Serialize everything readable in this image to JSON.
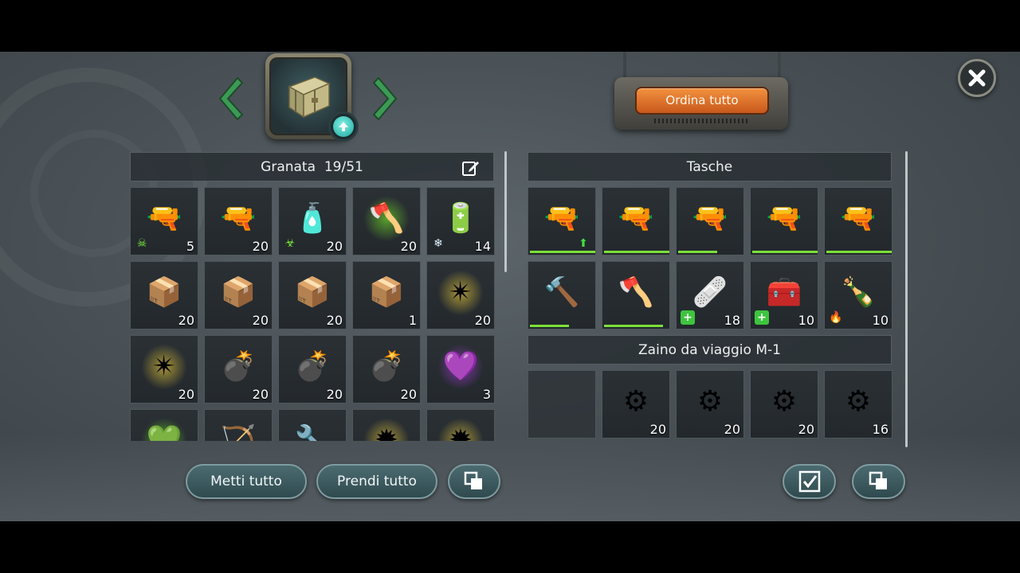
{
  "container": {
    "header_label": "Granata",
    "header_count": "19/51"
  },
  "sort_button": "Ordina tutto",
  "pockets": {
    "title": "Tasche",
    "items": [
      {
        "name": "rifle-green-upgrade",
        "glyph": "🔫",
        "qty": "",
        "durability": 1.0,
        "corner": "up-arrow"
      },
      {
        "name": "rifle-green",
        "glyph": "🔫",
        "qty": "",
        "durability": 1.0,
        "corner": ""
      },
      {
        "name": "rifle-green",
        "glyph": "🔫",
        "qty": "",
        "durability": 0.6,
        "corner": ""
      },
      {
        "name": "rifle-green",
        "glyph": "🔫",
        "qty": "",
        "durability": 1.0,
        "corner": ""
      },
      {
        "name": "hunting-rifle",
        "glyph": "🔫",
        "qty": "",
        "durability": 1.0,
        "corner": ""
      },
      {
        "name": "sledgehammer",
        "glyph": "🔨",
        "qty": "",
        "durability": 0.6,
        "corner": ""
      },
      {
        "name": "axe",
        "glyph": "🪓",
        "qty": "",
        "durability": 0.9,
        "corner": ""
      },
      {
        "name": "bandage",
        "glyph": "🩹",
        "qty": "18",
        "durability": null,
        "corner": "medkit"
      },
      {
        "name": "medical-device",
        "glyph": "🧰",
        "qty": "10",
        "durability": null,
        "corner": "medkit"
      },
      {
        "name": "molotov",
        "glyph": "🍾",
        "qty": "10",
        "durability": null,
        "corner": "fire"
      }
    ]
  },
  "backpack": {
    "title": "Zaino da viaggio M-1",
    "items": [
      {
        "name": "empty",
        "glyph": "",
        "qty": ""
      },
      {
        "name": "scrap-parts",
        "glyph": "⚙",
        "qty": "20"
      },
      {
        "name": "scrap-parts",
        "glyph": "⚙",
        "qty": "20"
      },
      {
        "name": "scrap-parts",
        "glyph": "⚙",
        "qty": "20"
      },
      {
        "name": "scrap-parts",
        "glyph": "⚙",
        "qty": "16"
      }
    ]
  },
  "storage_items": [
    {
      "name": "plasma-gun",
      "glyph": "🔫",
      "qty": "5",
      "glow": "",
      "corner": "toxic"
    },
    {
      "name": "gas-launcher",
      "glyph": "🔫",
      "qty": "20",
      "glow": "",
      "corner": ""
    },
    {
      "name": "toxic-sprayer",
      "glyph": "🧴",
      "qty": "20",
      "glow": "",
      "corner": "biohazard"
    },
    {
      "name": "throwing-axe",
      "glyph": "🪓",
      "qty": "20",
      "glow": "green",
      "corner": ""
    },
    {
      "name": "cryo-canister",
      "glyph": "🔋",
      "qty": "14",
      "glow": "",
      "corner": "snowflake"
    },
    {
      "name": "bandage-pack",
      "glyph": "📦",
      "qty": "20",
      "glow": "",
      "corner": ""
    },
    {
      "name": "bandage-pack",
      "glyph": "📦",
      "qty": "20",
      "glow": "",
      "corner": ""
    },
    {
      "name": "bandage-pack",
      "glyph": "📦",
      "qty": "20",
      "glow": "",
      "corner": ""
    },
    {
      "name": "bandage-pack",
      "glyph": "📦",
      "qty": "1",
      "glow": "",
      "corner": ""
    },
    {
      "name": "shuriken-gold",
      "glyph": "✴",
      "qty": "20",
      "glow": "gold",
      "corner": ""
    },
    {
      "name": "shuriken-gold",
      "glyph": "✴",
      "qty": "20",
      "glow": "gold",
      "corner": ""
    },
    {
      "name": "frag-grenade",
      "glyph": "💣",
      "qty": "20",
      "glow": "",
      "corner": ""
    },
    {
      "name": "frag-grenade",
      "glyph": "💣",
      "qty": "20",
      "glow": "",
      "corner": ""
    },
    {
      "name": "frag-grenade",
      "glyph": "💣",
      "qty": "20",
      "glow": "",
      "corner": ""
    },
    {
      "name": "purple-grenade",
      "glyph": "💜",
      "qty": "3",
      "glow": "purple",
      "corner": ""
    },
    {
      "name": "green-grenade",
      "glyph": "💚",
      "qty": "",
      "glow": "green",
      "corner": ""
    },
    {
      "name": "red-crossbow",
      "glyph": "🏹",
      "qty": "",
      "glow": "",
      "corner": ""
    },
    {
      "name": "red-tool",
      "glyph": "🔧",
      "qty": "",
      "glow": "",
      "corner": ""
    },
    {
      "name": "gold-spike",
      "glyph": "✹",
      "qty": "",
      "glow": "gold",
      "corner": ""
    },
    {
      "name": "gold-spike",
      "glyph": "✹",
      "qty": "",
      "glow": "gold",
      "corner": ""
    }
  ],
  "buttons": {
    "put_all": "Metti tutto",
    "take_all": "Prendi tutto"
  }
}
